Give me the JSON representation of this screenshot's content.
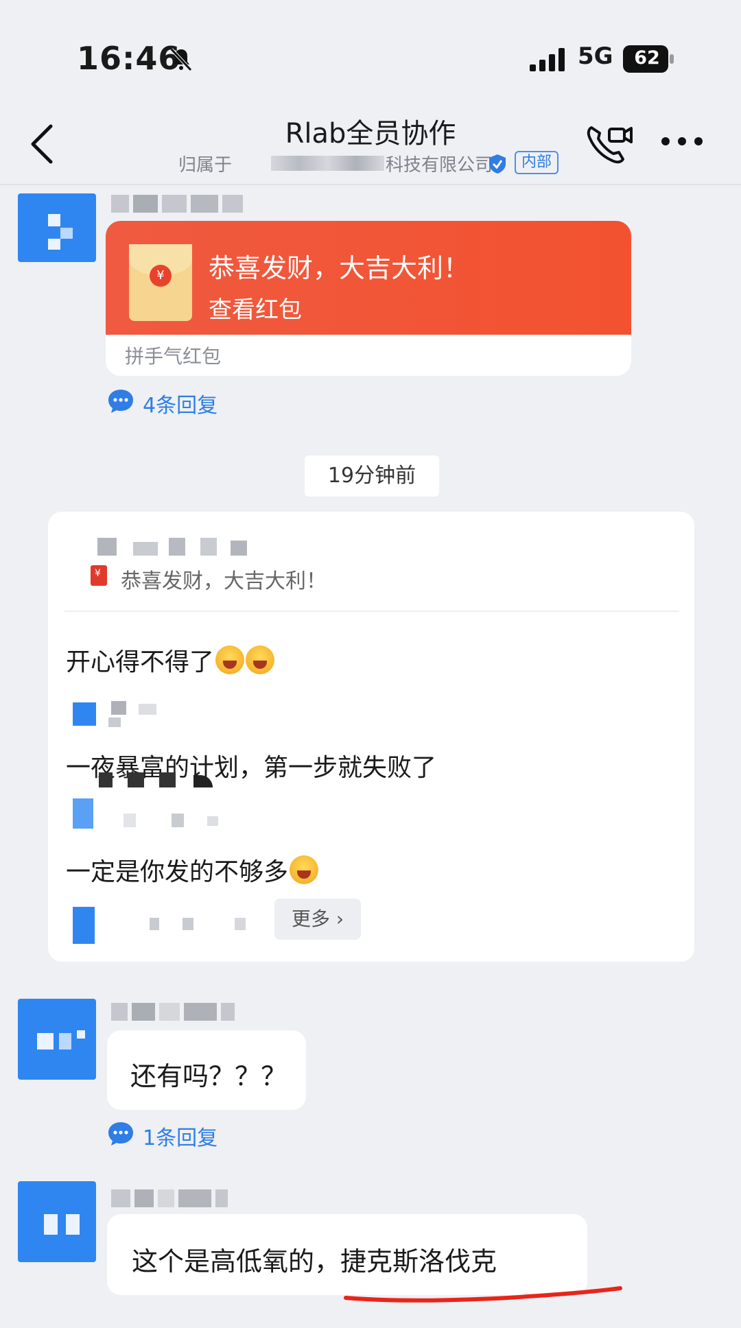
{
  "status_bar": {
    "time": "16:46",
    "network": "5G",
    "battery": "62"
  },
  "header": {
    "title": "Rlab全员协作",
    "subtitle_prefix": "归属于",
    "subtitle_suffix": "科技有限公司",
    "tag": "内部"
  },
  "messages": {
    "red_packet": {
      "greeting": "恭喜发财，大吉大利！",
      "action": "查看红包",
      "type_label": "拼手气红包",
      "replies": "4条回复"
    },
    "time_divider": "19分钟前",
    "thread_card": {
      "quote": "恭喜发财，大吉大利！",
      "lines": [
        "开心得不得了",
        "一夜暴富的计划，第一步就失败了",
        "一定是你发的不够多"
      ],
      "more": "更多"
    },
    "msg_2": {
      "text": "还有吗？？？",
      "replies": "1条回复"
    },
    "msg_3": {
      "text": "这个是高低氧的，捷克斯洛伐克"
    }
  },
  "colors": {
    "accent": "#2f7de5",
    "red_packet": "#f2522f",
    "background": "#eef0f4"
  }
}
